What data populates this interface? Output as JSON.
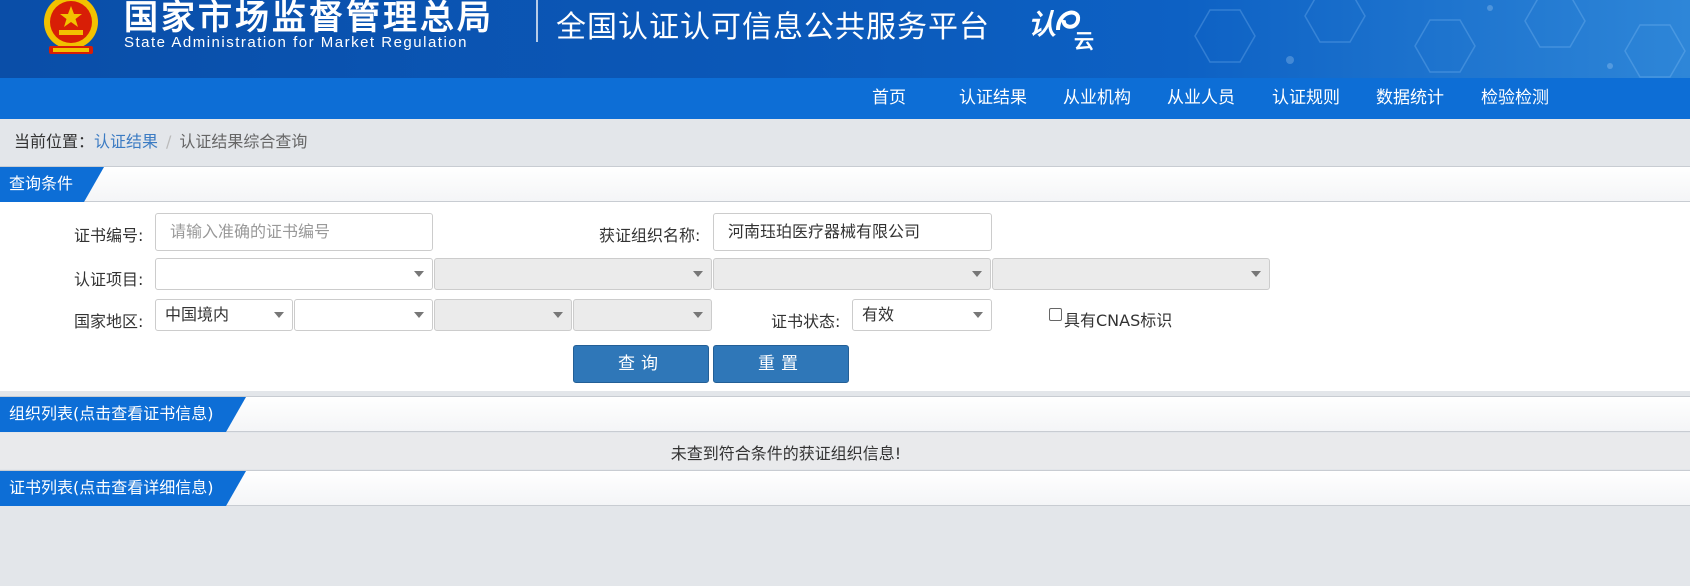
{
  "header": {
    "agency_cn": "国家市场监督管理总局",
    "agency_en": "State Administration  for  Market Regulation",
    "platform_title": "全国认证认可信息公共服务平台",
    "logo_text": "认e云",
    "brand_color": "#0d6ed6"
  },
  "nav": {
    "items": [
      {
        "label": "首页"
      },
      {
        "label": "认证结果"
      },
      {
        "label": "从业机构"
      },
      {
        "label": "从业人员"
      },
      {
        "label": "认证规则"
      },
      {
        "label": "数据统计"
      },
      {
        "label": "检验检测"
      }
    ]
  },
  "breadcrumb": {
    "prefix": "当前位置：",
    "parent": "认证结果",
    "separator": "/",
    "current": "认证结果综合查询"
  },
  "query": {
    "section_title": "查询条件",
    "cert_no_label": "证书编号:",
    "cert_no_placeholder": "请输入准确的证书编号",
    "cert_no_value": "",
    "org_name_label": "获证组织名称:",
    "org_name_value": "河南珏珀医疗器械有限公司",
    "project_label": "认证项目:",
    "project_values": [
      "",
      "",
      "",
      ""
    ],
    "region_label": "国家地区:",
    "region_values": [
      "中国境内",
      "",
      "",
      ""
    ],
    "status_label": "证书状态:",
    "status_value": "有效",
    "cnas_label": "具有CNAS标识",
    "cnas_checked": false,
    "search_button": "查询",
    "reset_button": "重置"
  },
  "org_list": {
    "section_title": "组织列表(点击查看证书信息)",
    "empty_message": "未查到符合条件的获证组织信息!"
  },
  "cert_list": {
    "section_title": "证书列表(点击查看详细信息)"
  }
}
